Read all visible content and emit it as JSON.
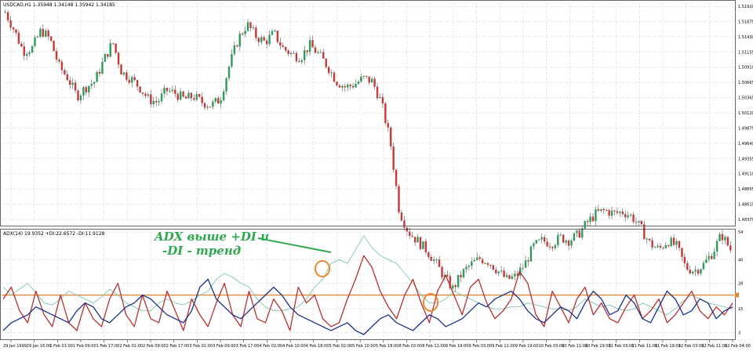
{
  "chart_data": [
    {
      "type": "candlestick",
      "title": "USDCAD,H1  1.35948 1.34148 1.35942 1.34185",
      "symbol": "USDCAD",
      "timeframe": "H1",
      "ylim": [
        1.486,
        1.5225
      ],
      "grid": true,
      "y_ticks": [
        "1.51920",
        "1.51675",
        "1.51430",
        "1.51155",
        "1.50910",
        "1.50665",
        "1.50365",
        "1.50120",
        "1.49875",
        "1.49640",
        "1.49355",
        "1.49110",
        "1.48855",
        "1.48610",
        "1.48379"
      ],
      "x_ticks": [
        "29 Jan 1999",
        "29 Jan 16:00",
        "1 Feb 01:00",
        "1 Feb 09:00",
        "1 Feb 17:00",
        "2 Feb 01:00",
        "2 Feb 09:00",
        "2 Feb 17:00",
        "3 Feb 01:00",
        "3 Feb 09:00",
        "3 Feb 17:00",
        "4 Feb 02:00",
        "4 Feb 10:00",
        "4 Feb 18:00",
        "5 Feb 02:00",
        "5 Feb 10:00",
        "5 Feb 18:00",
        "8 Feb 03:00",
        "8 Feb 11:00",
        "8 Feb 19:00",
        "9 Feb 03:00",
        "9 Feb 11:00",
        "9 Feb 19:00",
        "10 Feb 03:00",
        "10 Feb 11:00",
        "10 Feb 19:00",
        "11 Feb 03:00",
        "11 Feb 11:00",
        "11 Feb 19:00",
        "12 Feb 03:00",
        "12 Feb 11:00",
        "12 Feb 04:00"
      ],
      "close_path": [
        1.521,
        1.518,
        1.5145,
        1.515,
        1.518,
        1.5165,
        1.512,
        1.51,
        1.507,
        1.5085,
        1.5095,
        1.513,
        1.516,
        1.511,
        1.51,
        1.5085,
        1.5065,
        1.506,
        1.508,
        1.5075,
        1.5065,
        1.507,
        1.506,
        1.5055,
        1.5065,
        1.512,
        1.5165,
        1.519,
        1.517,
        1.516,
        1.5175,
        1.515,
        1.514,
        1.5135,
        1.5155,
        1.514,
        1.512,
        1.5095,
        1.5085,
        1.509,
        1.51,
        1.5095,
        1.506,
        1.4995,
        1.488,
        1.4845,
        1.483,
        1.4815,
        1.4795,
        1.477,
        1.475,
        1.4775,
        1.479,
        1.48,
        1.4795,
        1.478,
        1.4765,
        1.477,
        1.479,
        1.482,
        1.483,
        1.4825,
        1.4835,
        1.483,
        1.484,
        1.486,
        1.4875,
        1.488,
        1.4875,
        1.4878,
        1.487,
        1.485,
        1.4825,
        1.4815,
        1.483,
        1.482,
        1.4785,
        1.478,
        1.479,
        1.481,
        1.484,
        1.4815
      ]
    },
    {
      "type": "line",
      "title": "ADX(14) 19.9352 +DI:22.6572 -DI:11.9128",
      "ylim": [
        0,
        54
      ],
      "y_ticks": [
        54,
        40,
        28,
        15,
        3
      ],
      "reference_line": 22,
      "series": [
        {
          "name": "ADX",
          "color": "#7ec4ae",
          "values": [
            26,
            22,
            25,
            28,
            23,
            18,
            17,
            20,
            24,
            22,
            20,
            18,
            21,
            25,
            22,
            18,
            16,
            14,
            14,
            18,
            20,
            18,
            17,
            19,
            22,
            24,
            30,
            33,
            31,
            28,
            26,
            20,
            16,
            14,
            14,
            15,
            16,
            20,
            26,
            30,
            38,
            40,
            38,
            45,
            52,
            46,
            42,
            40,
            38,
            33,
            28,
            22,
            18,
            18,
            20,
            24,
            22,
            20,
            18,
            16,
            15,
            15,
            16,
            16,
            18,
            17,
            16,
            15,
            15,
            14,
            16,
            20,
            18,
            16,
            17,
            15,
            14,
            15,
            18,
            16,
            14,
            12,
            15,
            19,
            22,
            20,
            18,
            17,
            16,
            15
          ]
        },
        {
          "name": "+DI",
          "color": "#b83030",
          "values": [
            20,
            26,
            14,
            8,
            24,
            12,
            6,
            22,
            8,
            4,
            18,
            10,
            6,
            20,
            28,
            12,
            6,
            22,
            10,
            8,
            24,
            14,
            4,
            20,
            12,
            6,
            18,
            28,
            12,
            6,
            24,
            10,
            8,
            20,
            14,
            4,
            26,
            18,
            22,
            10,
            6,
            8,
            20,
            30,
            42,
            36,
            24,
            16,
            10,
            22,
            30,
            18,
            8,
            24,
            32,
            22,
            12,
            26,
            30,
            18,
            10,
            14,
            20,
            34,
            28,
            12,
            6,
            24,
            16,
            8,
            20,
            26,
            12,
            18,
            10,
            8,
            16,
            22,
            10,
            14,
            20,
            8,
            12,
            18,
            24,
            14,
            10,
            16,
            12,
            18
          ]
        },
        {
          "name": "-DI",
          "color": "#1a2f8c",
          "values": [
            4,
            8,
            10,
            12,
            16,
            14,
            12,
            10,
            8,
            14,
            18,
            16,
            10,
            8,
            12,
            16,
            18,
            22,
            20,
            16,
            12,
            10,
            8,
            14,
            26,
            30,
            20,
            16,
            12,
            10,
            14,
            18,
            22,
            26,
            22,
            16,
            12,
            10,
            8,
            6,
            4,
            6,
            8,
            4,
            2,
            6,
            10,
            12,
            8,
            6,
            4,
            8,
            12,
            10,
            6,
            8,
            10,
            14,
            18,
            16,
            20,
            22,
            24,
            20,
            14,
            10,
            8,
            12,
            16,
            14,
            10,
            18,
            24,
            20,
            12,
            14,
            22,
            18,
            10,
            8,
            16,
            24,
            20,
            12,
            14,
            20,
            18,
            10,
            14,
            16
          ]
        }
      ]
    }
  ],
  "annotation": {
    "line1": "ADX выше +DI и",
    "line2": "-DI - тренд"
  },
  "colors": {
    "bull_candle": "#2e9a5b",
    "bear_candle": "#c43a3a",
    "reference_line": "#e08a3a",
    "highlight_circle": "#e8892e",
    "annotation_text": "#2fa84f"
  }
}
